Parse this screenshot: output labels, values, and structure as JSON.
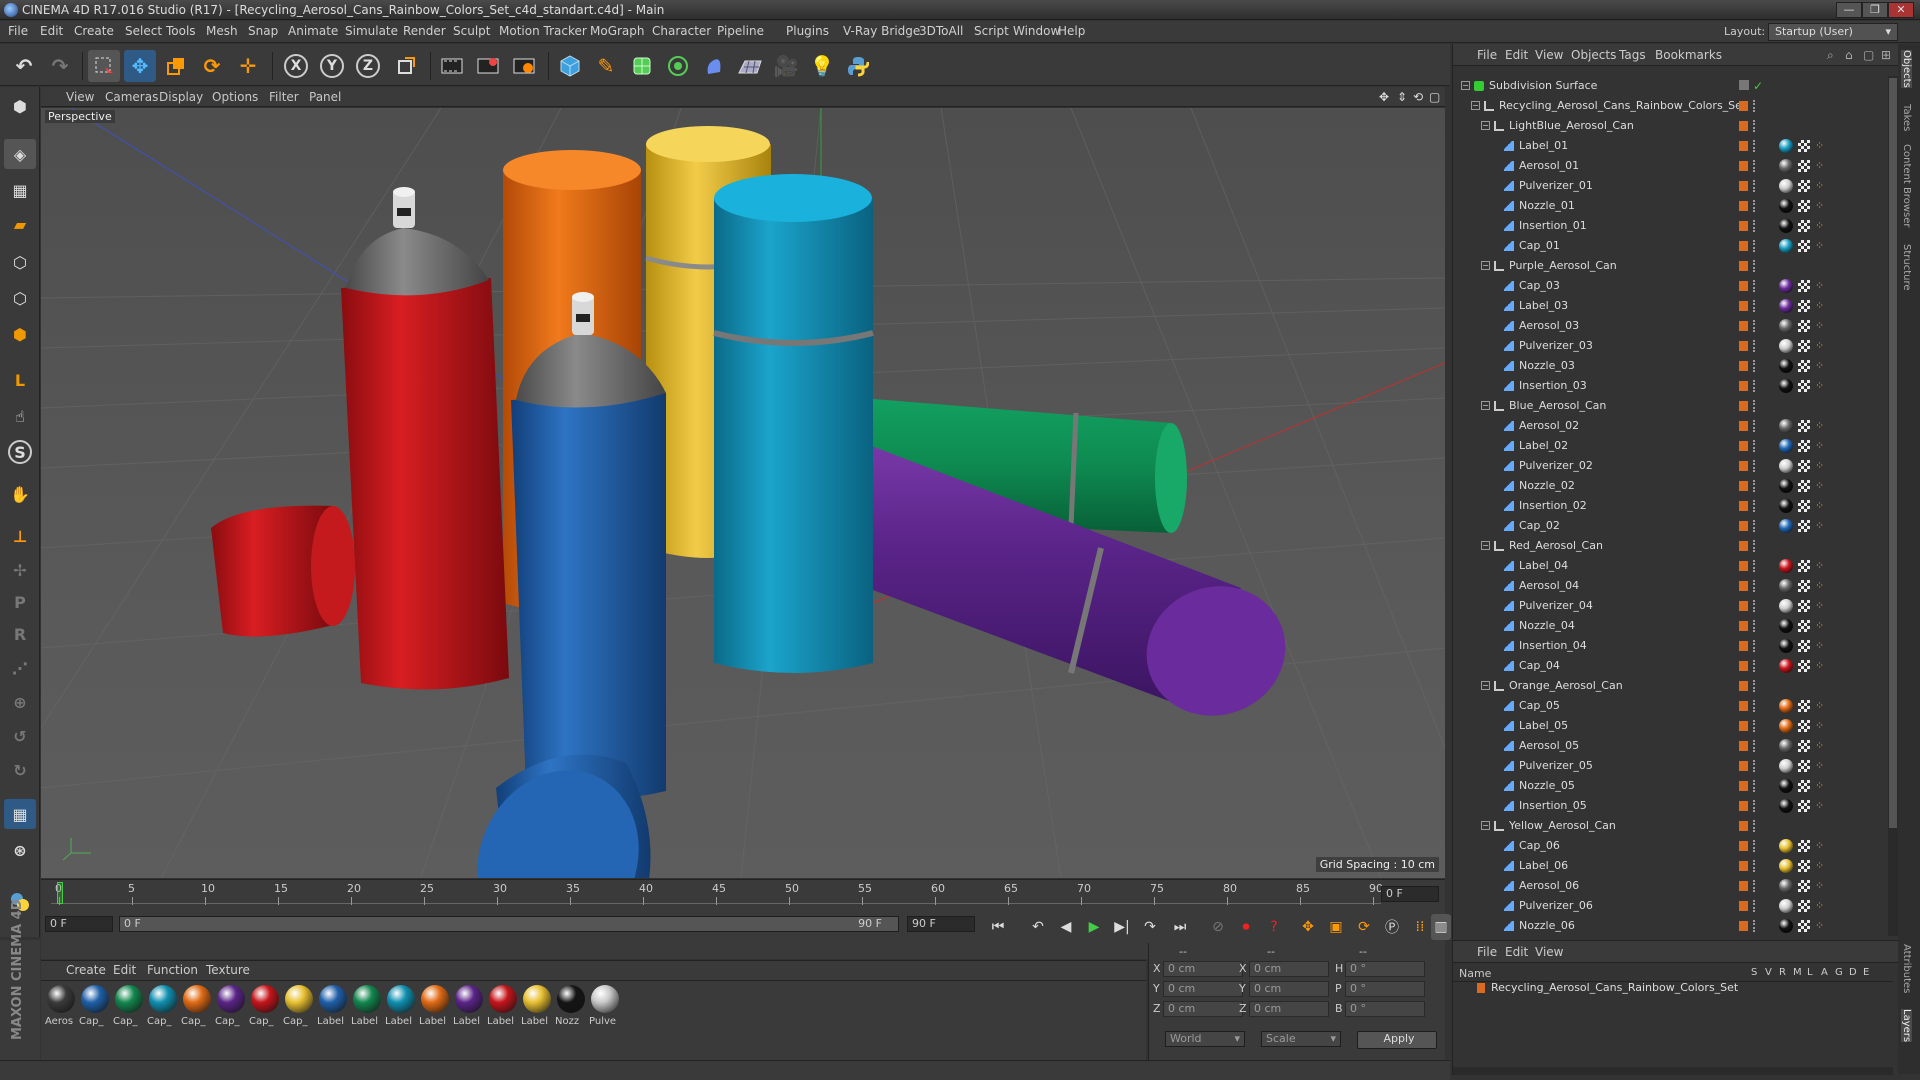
{
  "window": {
    "title": "CINEMA 4D R17.016 Studio (R17) - [Recycling_Aerosol_Cans_Rainbow_Colors_Set_c4d_standart.c4d] - Main",
    "minimize": "—",
    "maximize": "❐",
    "close": "✕"
  },
  "menubar": {
    "items": [
      "File",
      "Edit",
      "Create",
      "Select",
      "Tools",
      "Mesh",
      "Snap",
      "Animate",
      "Simulate",
      "Render",
      "Sculpt",
      "Motion Tracker",
      "MoGraph",
      "Character",
      "Pipeline",
      "Plugins",
      "V-Ray Bridge",
      "3DToAll",
      "Script",
      "Window",
      "Help"
    ],
    "layout_label": "Layout:",
    "layout_value": "Startup (User)"
  },
  "toolbar": {
    "icons": [
      "undo-icon",
      "redo-icon",
      "live-selection-icon",
      "move-icon",
      "scale-icon",
      "rotate-icon",
      "transform-icon",
      "x-axis-icon",
      "y-axis-icon",
      "z-axis-icon",
      "coordinate-system-icon",
      "render-view-icon",
      "render-picture-viewer-icon",
      "edit-render-settings-icon",
      "cube-icon",
      "pen-icon",
      "subdivision-icon",
      "array-icon",
      "deformer-icon",
      "floor-icon",
      "camera-icon",
      "light-icon",
      "python-icon"
    ],
    "x": "X",
    "y": "Y",
    "z": "Z"
  },
  "viewport": {
    "menu": [
      "View",
      "Cameras",
      "Display",
      "Options",
      "Filter",
      "Panel"
    ],
    "name": "Perspective",
    "grid_spacing": "Grid Spacing : 10 cm"
  },
  "timeline": {
    "ticks": [
      "0",
      "5",
      "10",
      "15",
      "20",
      "25",
      "30",
      "35",
      "40",
      "45",
      "50",
      "55",
      "60",
      "65",
      "70",
      "75",
      "80",
      "85",
      "90"
    ],
    "current_frame_right": "0 F",
    "start_frame": "0 F",
    "range_start": "0 F",
    "range_end": "90 F",
    "end_frame": "90 F"
  },
  "materials": {
    "menu": [
      "Create",
      "Edit",
      "Function",
      "Texture"
    ],
    "items": [
      {
        "label": "Aeros",
        "color": "#3a3a3a"
      },
      {
        "label": "Cap_",
        "color": "#1f5fa8"
      },
      {
        "label": "Cap_",
        "color": "#12864e"
      },
      {
        "label": "Cap_",
        "color": "#0f8fb0"
      },
      {
        "label": "Cap_",
        "color": "#e06a14"
      },
      {
        "label": "Cap_",
        "color": "#5a2488"
      },
      {
        "label": "Cap_",
        "color": "#c4141a"
      },
      {
        "label": "Cap_",
        "color": "#e8c030"
      },
      {
        "label": "Label",
        "color": "#1f5fa8"
      },
      {
        "label": "Label",
        "color": "#12864e"
      },
      {
        "label": "Label",
        "color": "#0f8fb0"
      },
      {
        "label": "Label",
        "color": "#e06a14"
      },
      {
        "label": "Label",
        "color": "#5a2488"
      },
      {
        "label": "Label",
        "color": "#c4141a"
      },
      {
        "label": "Label",
        "color": "#e8c030"
      },
      {
        "label": "Nozz",
        "color": "#151515"
      },
      {
        "label": "Pulve",
        "color": "#c8c8c8"
      }
    ]
  },
  "coords": {
    "header": [
      "--",
      "--",
      "--"
    ],
    "rows": [
      {
        "a": "X",
        "av": "0 cm",
        "b": "X",
        "bv": "0 cm",
        "c": "H",
        "cv": "0 °"
      },
      {
        "a": "Y",
        "av": "0 cm",
        "b": "Y",
        "bv": "0 cm",
        "c": "P",
        "cv": "0 °"
      },
      {
        "a": "Z",
        "av": "0 cm",
        "b": "Z",
        "bv": "0 cm",
        "c": "B",
        "cv": "0 °"
      }
    ],
    "world": "World",
    "scale": "Scale",
    "apply": "Apply"
  },
  "objects": {
    "menu": [
      "File",
      "Edit",
      "View",
      "Objects",
      "Tags",
      "Bookmarks"
    ],
    "rows": [
      {
        "indent": 0,
        "type": "subd",
        "name": "Subdivision Surface",
        "tag": ""
      },
      {
        "indent": 1,
        "type": "null",
        "name": "Recycling_Aerosol_Cans_Rainbow_Colors_Set",
        "tag": ""
      },
      {
        "indent": 2,
        "type": "null",
        "name": "LightBlue_Aerosol_Can",
        "tag": ""
      },
      {
        "indent": 3,
        "type": "poly",
        "name": "Label_01",
        "tag": "#1a9ec4"
      },
      {
        "indent": 3,
        "type": "poly",
        "name": "Aerosol_01",
        "tag": "#666"
      },
      {
        "indent": 3,
        "type": "poly",
        "name": "Pulverizer_01",
        "tag": "#cfcfcf"
      },
      {
        "indent": 3,
        "type": "poly",
        "name": "Nozzle_01",
        "tag": "#111"
      },
      {
        "indent": 3,
        "type": "poly",
        "name": "Insertion_01",
        "tag": "#111"
      },
      {
        "indent": 3,
        "type": "poly",
        "name": "Cap_01",
        "tag": "#1a9ec4"
      },
      {
        "indent": 2,
        "type": "null",
        "name": "Purple_Aerosol_Can",
        "tag": ""
      },
      {
        "indent": 3,
        "type": "poly",
        "name": "Cap_03",
        "tag": "#6a2c9c"
      },
      {
        "indent": 3,
        "type": "poly",
        "name": "Label_03",
        "tag": "#6a2c9c"
      },
      {
        "indent": 3,
        "type": "poly",
        "name": "Aerosol_03",
        "tag": "#666"
      },
      {
        "indent": 3,
        "type": "poly",
        "name": "Pulverizer_03",
        "tag": "#cfcfcf"
      },
      {
        "indent": 3,
        "type": "poly",
        "name": "Nozzle_03",
        "tag": "#111"
      },
      {
        "indent": 3,
        "type": "poly",
        "name": "Insertion_03",
        "tag": "#111"
      },
      {
        "indent": 2,
        "type": "null",
        "name": "Blue_Aerosol_Can",
        "tag": ""
      },
      {
        "indent": 3,
        "type": "poly",
        "name": "Aerosol_02",
        "tag": "#666"
      },
      {
        "indent": 3,
        "type": "poly",
        "name": "Label_02",
        "tag": "#2068b8"
      },
      {
        "indent": 3,
        "type": "poly",
        "name": "Pulverizer_02",
        "tag": "#cfcfcf"
      },
      {
        "indent": 3,
        "type": "poly",
        "name": "Nozzle_02",
        "tag": "#111"
      },
      {
        "indent": 3,
        "type": "poly",
        "name": "Insertion_02",
        "tag": "#111"
      },
      {
        "indent": 3,
        "type": "poly",
        "name": "Cap_02",
        "tag": "#2068b8"
      },
      {
        "indent": 2,
        "type": "null",
        "name": "Red_Aerosol_Can",
        "tag": ""
      },
      {
        "indent": 3,
        "type": "poly",
        "name": "Label_04",
        "tag": "#c8161c"
      },
      {
        "indent": 3,
        "type": "poly",
        "name": "Aerosol_04",
        "tag": "#666"
      },
      {
        "indent": 3,
        "type": "poly",
        "name": "Pulverizer_04",
        "tag": "#cfcfcf"
      },
      {
        "indent": 3,
        "type": "poly",
        "name": "Nozzle_04",
        "tag": "#111"
      },
      {
        "indent": 3,
        "type": "poly",
        "name": "Insertion_04",
        "tag": "#111"
      },
      {
        "indent": 3,
        "type": "poly",
        "name": "Cap_04",
        "tag": "#c8161c"
      },
      {
        "indent": 2,
        "type": "null",
        "name": "Orange_Aerosol_Can",
        "tag": ""
      },
      {
        "indent": 3,
        "type": "poly",
        "name": "Cap_05",
        "tag": "#e06a14"
      },
      {
        "indent": 3,
        "type": "poly",
        "name": "Label_05",
        "tag": "#e06a14"
      },
      {
        "indent": 3,
        "type": "poly",
        "name": "Aerosol_05",
        "tag": "#666"
      },
      {
        "indent": 3,
        "type": "poly",
        "name": "Pulverizer_05",
        "tag": "#cfcfcf"
      },
      {
        "indent": 3,
        "type": "poly",
        "name": "Nozzle_05",
        "tag": "#111"
      },
      {
        "indent": 3,
        "type": "poly",
        "name": "Insertion_05",
        "tag": "#111"
      },
      {
        "indent": 2,
        "type": "null",
        "name": "Yellow_Aerosol_Can",
        "tag": ""
      },
      {
        "indent": 3,
        "type": "poly",
        "name": "Cap_06",
        "tag": "#e8c030"
      },
      {
        "indent": 3,
        "type": "poly",
        "name": "Label_06",
        "tag": "#e8c030"
      },
      {
        "indent": 3,
        "type": "poly",
        "name": "Aerosol_06",
        "tag": "#666"
      },
      {
        "indent": 3,
        "type": "poly",
        "name": "Pulverizer_06",
        "tag": "#cfcfcf"
      },
      {
        "indent": 3,
        "type": "poly",
        "name": "Nozzle_06",
        "tag": "#111"
      }
    ]
  },
  "attributes": {
    "menu": [
      "File",
      "Edit",
      "View"
    ],
    "col_name": "Name",
    "cols": [
      "S",
      "V",
      "R",
      "M",
      "L",
      "A",
      "G",
      "D",
      "E"
    ],
    "row_name": "Recycling_Aerosol_Cans_Rainbow_Colors_Set"
  },
  "sidetabs": [
    "Objects",
    "Takes",
    "Content Browser",
    "Structure",
    "Attributes",
    "Layers"
  ],
  "brand": "MAXON CINEMA 4D",
  "colors": {
    "accent": "#d96a1f",
    "panel": "#3a3a3a",
    "dark": "#333333"
  }
}
